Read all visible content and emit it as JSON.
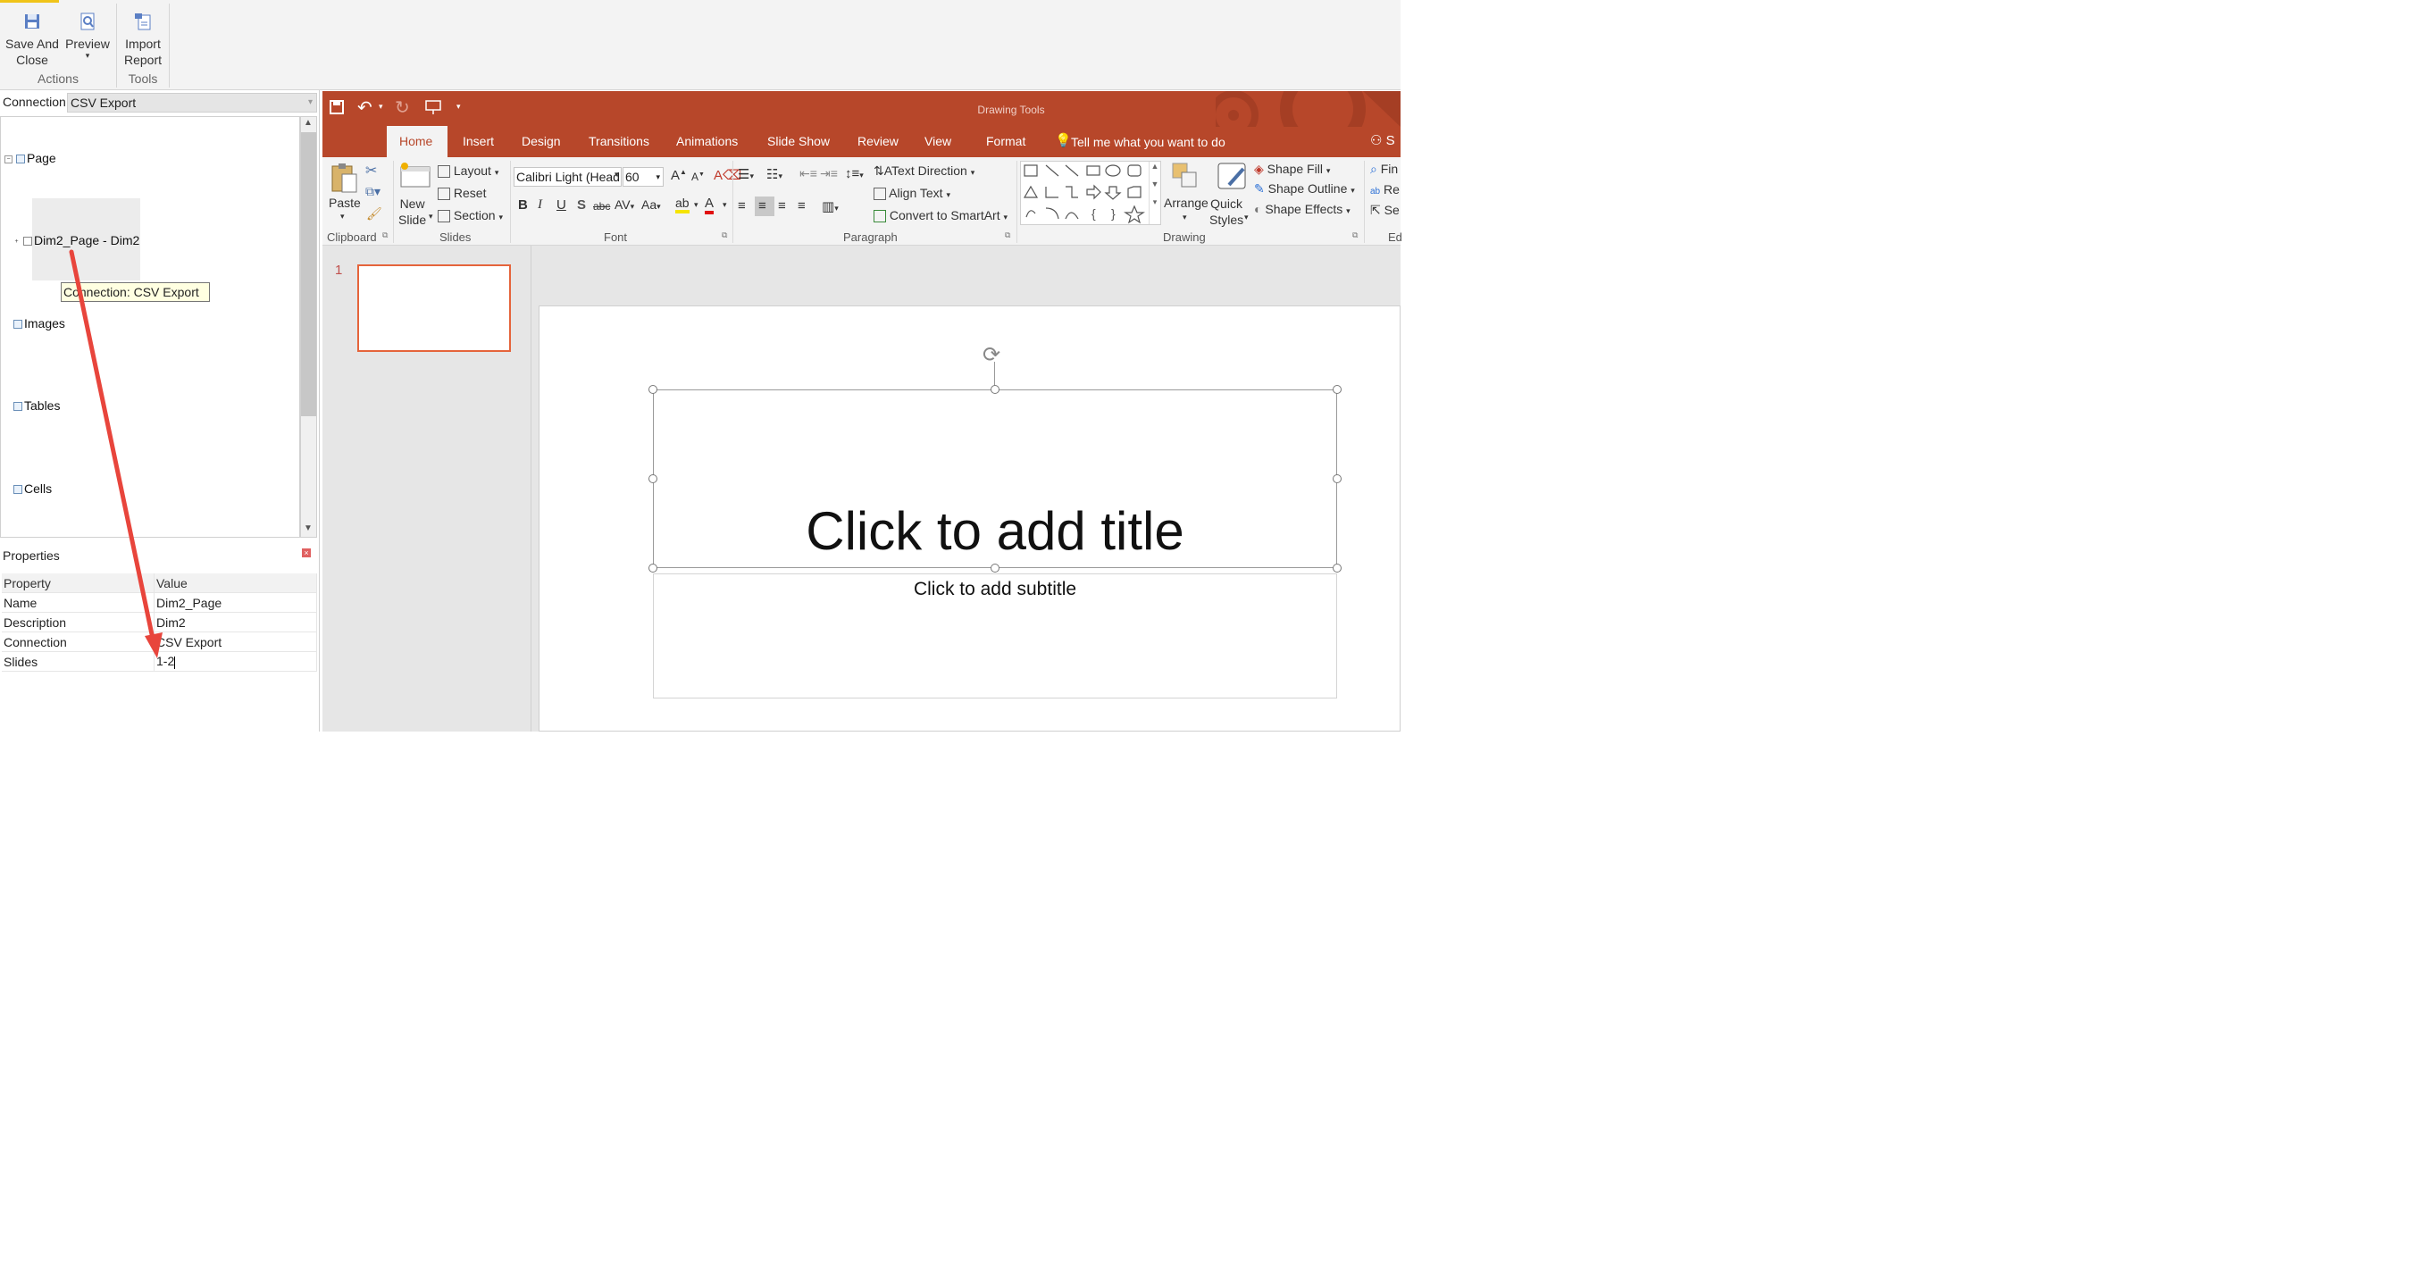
{
  "host_ribbon": {
    "actions": {
      "save_and_close": "Save And\nClose",
      "preview": "Preview",
      "group_label": "Actions"
    },
    "tools": {
      "import_report": "Import\nReport",
      "group_label": "Tools"
    }
  },
  "left_panel": {
    "connection_label": "Connection",
    "connection_value": "CSV Export",
    "tree": [
      {
        "label": "Page"
      },
      {
        "label": "Dim2_Page - Dim2"
      },
      {
        "label": "Images"
      },
      {
        "label": "Tables"
      },
      {
        "label": "Cells"
      }
    ],
    "tooltip": "Connection: CSV Export",
    "properties_title": "Properties",
    "properties": {
      "header": {
        "property": "Property",
        "value": "Value"
      },
      "rows": [
        {
          "property": "Name",
          "value": "Dim2_Page"
        },
        {
          "property": "Description",
          "value": "Dim2"
        },
        {
          "property": "Connection",
          "value": "CSV Export"
        },
        {
          "property": "Slides",
          "value": "1-2"
        }
      ]
    }
  },
  "ppt": {
    "drawing_tools": "Drawing Tools",
    "tabs": [
      "Home",
      "Insert",
      "Design",
      "Transitions",
      "Animations",
      "Slide Show",
      "Review",
      "View",
      "Format"
    ],
    "tell_me": "Tell me what you want to do",
    "clipboard": {
      "paste": "Paste",
      "label": "Clipboard"
    },
    "slides": {
      "new_slide": "New\nSlide",
      "layout": "Layout",
      "reset": "Reset",
      "section": "Section",
      "label": "Slides"
    },
    "font": {
      "family": "Calibri Light (Head",
      "size": "60",
      "label": "Font"
    },
    "paragraph": {
      "text_direction": "Text Direction",
      "align_text": "Align Text",
      "convert": "Convert to SmartArt",
      "label": "Paragraph"
    },
    "drawing": {
      "arrange": "Arrange",
      "quick_styles": "Quick\nStyles",
      "shape_fill": "Shape Fill",
      "shape_outline": "Shape Outline",
      "shape_effects": "Shape Effects",
      "label": "Drawing"
    },
    "editing": {
      "find": "Fin",
      "replace": "Re",
      "select": "Se",
      "label": "Ed"
    },
    "slide_number": "1",
    "title_placeholder": "Click to add title",
    "subtitle_placeholder": "Click to add subtitle"
  },
  "colors": {
    "ppt_accent": "#b7472a",
    "annotation_arrow": "#e8453c",
    "thumb_border": "#e5643b"
  }
}
